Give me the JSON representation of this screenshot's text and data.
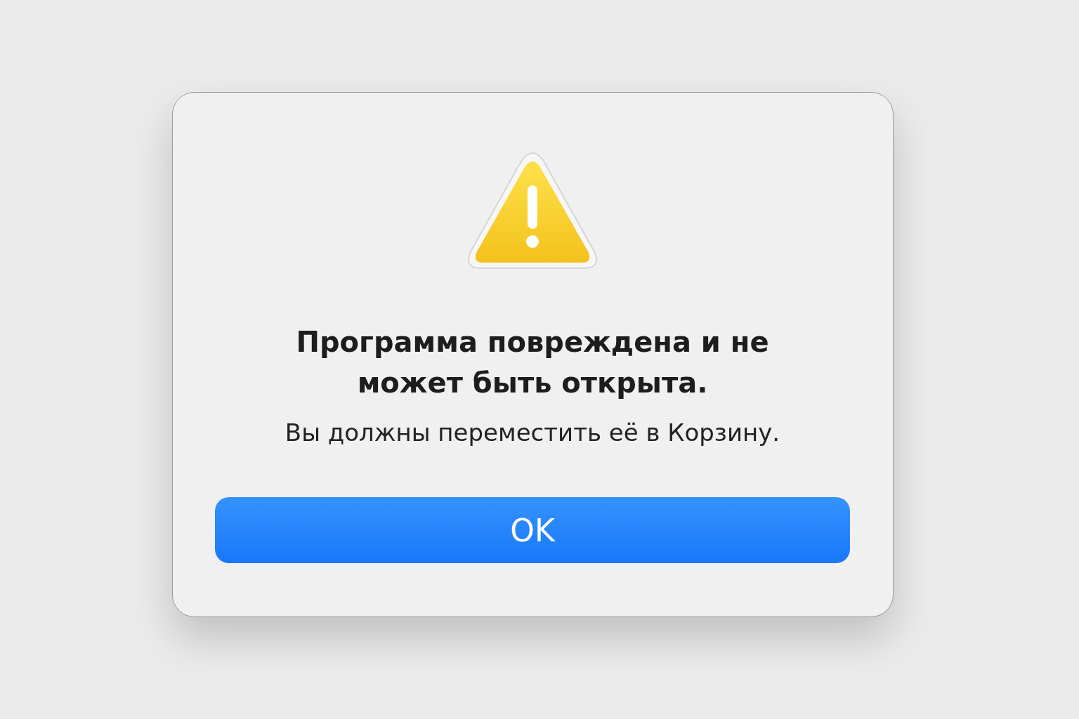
{
  "dialog": {
    "title": "Программа повреждена и не может быть открыта.",
    "message": "Вы должны переместить её в Корзину.",
    "buttons": [
      {
        "label": "OK",
        "kind": "default"
      }
    ]
  }
}
